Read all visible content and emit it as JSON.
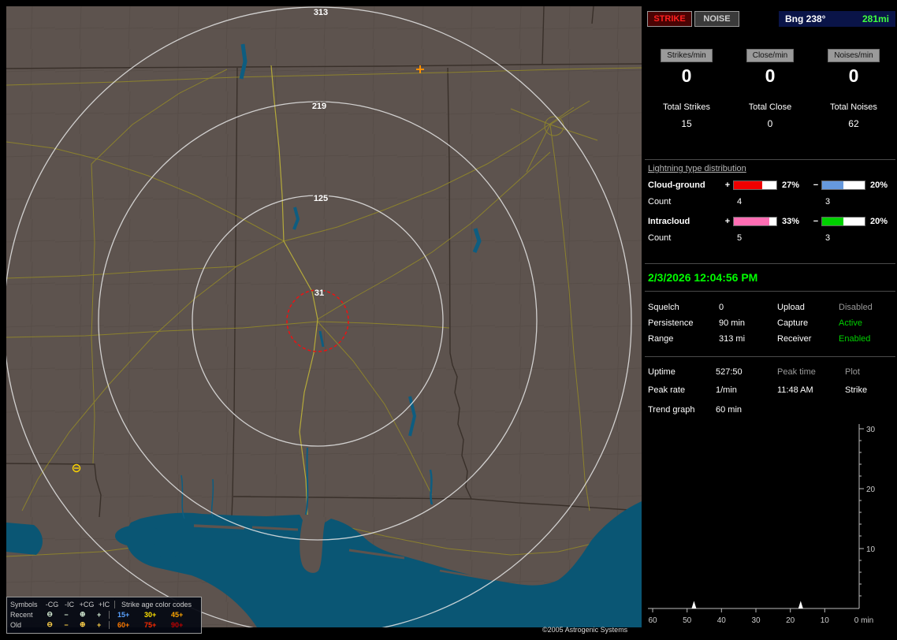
{
  "map": {
    "ring_labels": [
      "313",
      "219",
      "125",
      "31"
    ],
    "copyright": "©2005 Astrogenic Systems",
    "colors": {
      "land": "#5d534e",
      "water": "#0a5674",
      "range_ring": "#e6e6e6",
      "close_ring": "#ee1111",
      "road": "#948a28"
    },
    "strikes": [
      {
        "type": "+IC",
        "age": "old",
        "color": "#ff9000"
      },
      {
        "type": "-CG",
        "age": "old",
        "color": "#ffd700"
      }
    ],
    "legend": {
      "header_symbols": "Symbols",
      "symbol_cols": [
        "-CG",
        "-IC",
        "+CG",
        "+IC"
      ],
      "age_header": "Strike age color codes",
      "symbols": {
        "neg_cg": "⊖",
        "neg_ic": "−",
        "pos_cg": "⊕",
        "pos_ic": "+"
      },
      "symbol_color_recent": "#d8f0d8",
      "symbol_color_old": "#ffd24a",
      "rows": [
        {
          "label": "Recent",
          "age_values": [
            "15+",
            "30+",
            "45+"
          ],
          "age_colors": [
            "#5aa2ff",
            "#ffe100",
            "#ffa500"
          ]
        },
        {
          "label": "Old",
          "age_values": [
            "60+",
            "75+",
            "90+"
          ],
          "age_colors": [
            "#ff7a00",
            "#ff2a00",
            "#c00000"
          ]
        }
      ]
    }
  },
  "panel": {
    "strike_btn": "STRIKE",
    "noise_btn": "NOISE",
    "bearing_label": "Bng 238°",
    "bearing_distance": "281mi",
    "colors": {
      "green_bright": "#3fff3f",
      "green": "#00d000",
      "disabled_gray": "#9a9a9a"
    },
    "rates": [
      {
        "label": "Strikes/min",
        "value": "0"
      },
      {
        "label": "Close/min",
        "value": "0"
      },
      {
        "label": "Noises/min",
        "value": "0"
      }
    ],
    "totals": [
      {
        "label": "Total Strikes",
        "value": "15"
      },
      {
        "label": "Total Close",
        "value": "0"
      },
      {
        "label": "Total Noises",
        "value": "62"
      }
    ],
    "distribution": {
      "title": "Lightning type distribution",
      "count_label": "Count",
      "plus_sign": "+",
      "minus_sign": "−",
      "rows": [
        {
          "name": "Cloud-ground",
          "plus_pct": "27%",
          "minus_pct": "20%",
          "plus_count": "4",
          "minus_count": "3",
          "plus_color": "#f00000",
          "minus_color": "#6699dd"
        },
        {
          "name": "Intracloud",
          "plus_pct": "33%",
          "minus_pct": "20%",
          "plus_count": "5",
          "minus_count": "3",
          "plus_color": "#ff6eb4",
          "minus_color": "#00d000"
        }
      ]
    },
    "datetime": "2/3/2026 12:04:56 PM",
    "settings": [
      {
        "label": "Squelch",
        "value": "0",
        "label2": "Upload",
        "value2": "Disabled",
        "value2_color": "#9a9a9a"
      },
      {
        "label": "Persistence",
        "value": "90 min",
        "label2": "Capture",
        "value2": "Active",
        "value2_color": "#00d000"
      },
      {
        "label": "Range",
        "value": "313 mi",
        "label2": "Receiver",
        "value2": "Enabled",
        "value2_color": "#00d000"
      }
    ],
    "stats": {
      "uptime_label": "Uptime",
      "uptime": "527:50",
      "peaktime_label": "Peak time",
      "plot_label": "Plot",
      "peakrate_label": "Peak rate",
      "peakrate": "1/min",
      "peaktime": "11:48 AM",
      "plot": "Strike"
    },
    "trend": {
      "label": "Trend graph",
      "window": "60 min"
    }
  },
  "chart_data": {
    "type": "line",
    "title": "Trend graph (strike rate, last 60 min)",
    "xlabel": "min",
    "ylabel": "",
    "x_ticks": [
      "60",
      "50",
      "40",
      "30",
      "20",
      "10",
      "0 min"
    ],
    "y_ticks": [
      "30",
      "20",
      "10"
    ],
    "xlim": [
      60,
      0
    ],
    "ylim": [
      0,
      30
    ],
    "legend_position": "none",
    "grid": false,
    "series": [
      {
        "name": "Strike",
        "points": [
          {
            "min_ago": 48,
            "rate": 1
          },
          {
            "min_ago": 17,
            "rate": 1
          }
        ]
      }
    ]
  }
}
